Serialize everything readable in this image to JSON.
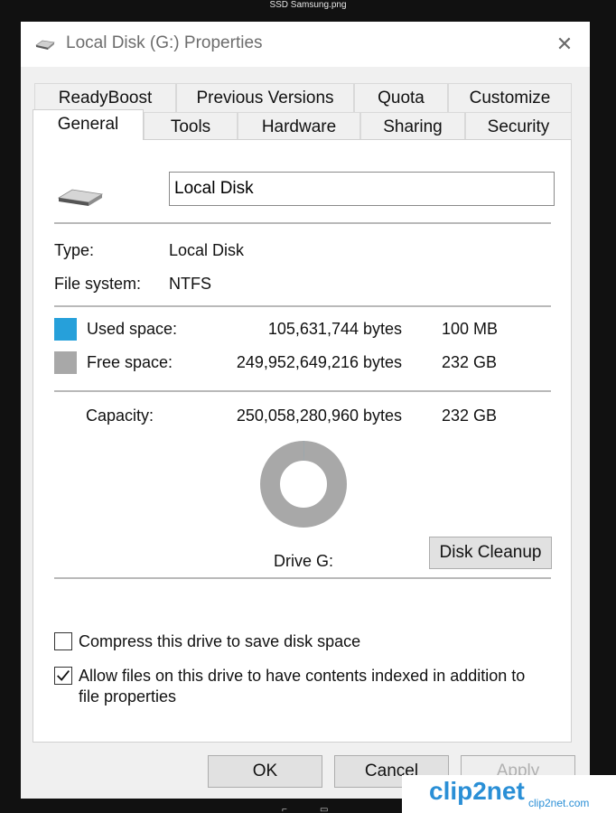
{
  "caption": "SSD Samsung.png",
  "window": {
    "title": "Local Disk (G:) Properties",
    "close_icon": "close-icon",
    "drive_icon": "drive-icon"
  },
  "tabs": {
    "row1": [
      "ReadyBoost",
      "Previous Versions",
      "Quota",
      "Customize"
    ],
    "row2": [
      "General",
      "Tools",
      "Hardware",
      "Sharing",
      "Security"
    ],
    "active": "General"
  },
  "general": {
    "name_value": "Local Disk",
    "type_label": "Type:",
    "type_value": "Local Disk",
    "fs_label": "File system:",
    "fs_value": "NTFS",
    "used_label": "Used space:",
    "used_bytes": "105,631,744 bytes",
    "used_size": "100 MB",
    "free_label": "Free space:",
    "free_bytes": "249,952,649,216 bytes",
    "free_size": "232 GB",
    "capacity_label": "Capacity:",
    "capacity_bytes": "250,058,280,960 bytes",
    "capacity_size": "232 GB",
    "drive_label": "Drive G:",
    "used_fraction": 0.0004,
    "disk_cleanup_label": "Disk Cleanup",
    "compress_label": "Compress this drive to save disk space",
    "compress_checked": false,
    "index_label_line1": "Allow files on this drive to have contents indexed in addition to",
    "index_label_line2": "file properties",
    "index_checked": true
  },
  "buttons": {
    "ok": "OK",
    "cancel": "Cancel",
    "apply": "Apply"
  },
  "colors": {
    "used": "#26a0da",
    "free": "#a8a8a8"
  },
  "watermark": {
    "site": "clip2net",
    "domain": ".com",
    "logo_text": "clip2net.com"
  }
}
